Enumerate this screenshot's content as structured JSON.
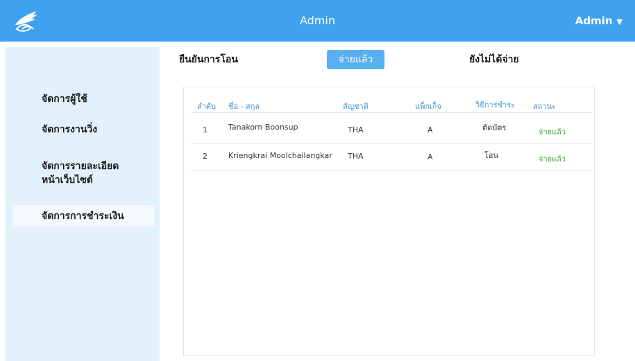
{
  "header": {
    "title": "Admin",
    "user_menu": "Admin",
    "caret": "▼"
  },
  "sidebar": {
    "items": [
      {
        "label": "จัดการผู้ใช้"
      },
      {
        "label": "จัดการงานวิ่ง"
      },
      {
        "label": "จัดการรายละเอียด\nหน้าเว็บไซต์"
      },
      {
        "label": "จัดการการชำระเงิน"
      }
    ]
  },
  "tabs": [
    {
      "label": "ยืนยันการโอน"
    },
    {
      "label": "จ่ายแล้ว"
    },
    {
      "label": "ยังไม่ได้จ่าย"
    }
  ],
  "table": {
    "headers": [
      "ลำดับ",
      "ชื่อ - สกุล",
      "สัญชาติ",
      "แพ็กเก็จ",
      "วิธีการชำระ",
      "สถานะ"
    ],
    "rows": [
      {
        "no": "1",
        "name": "Tanakorn Boonsup",
        "nationality": "THA",
        "package": "A",
        "method": "ตัดบัตร",
        "status": "จ่ายแล้ว"
      },
      {
        "no": "2",
        "name": "Kriengkrai Moolchailangkar",
        "nationality": "THA",
        "package": "A",
        "method": "โอน",
        "status": "จ่ายแล้ว"
      }
    ]
  },
  "colors": {
    "topbar": "#3fa2f0",
    "sidebar": "#e3f1fd",
    "active_tab": "#58b0f2",
    "header_text": "#3f93d6",
    "status_paid": "#3aa535"
  }
}
